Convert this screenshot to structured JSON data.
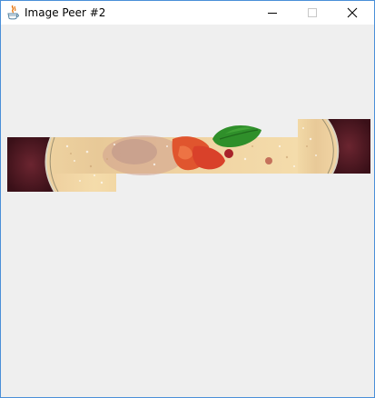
{
  "window": {
    "title": "Image Peer #2",
    "controls": {
      "minimize_icon": "minimize-icon",
      "maximize_icon": "maximize-icon",
      "close_icon": "close-icon"
    },
    "border_color": "#4a8fd8",
    "background_color": "#efefef"
  },
  "canvas": {
    "image_description_icon": "partially-rendered-image"
  }
}
